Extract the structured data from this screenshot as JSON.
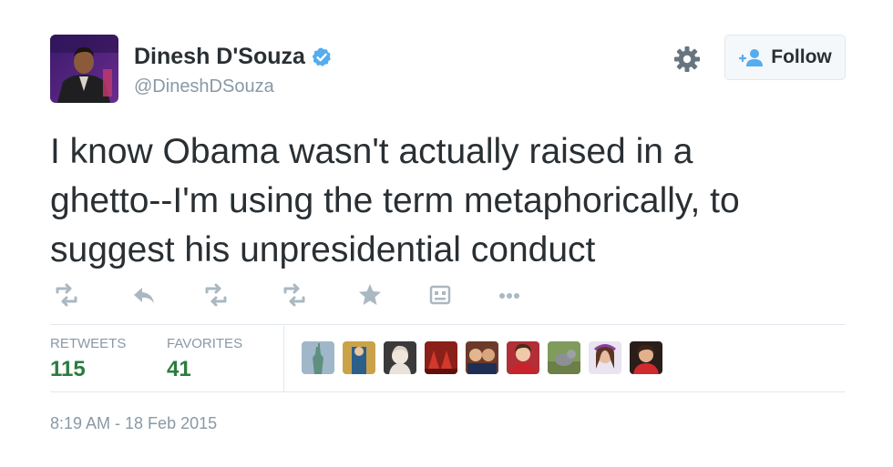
{
  "user": {
    "display_name": "Dinesh D'Souza",
    "handle": "@DineshDSouza"
  },
  "follow_button": {
    "label": "Follow"
  },
  "tweet": {
    "lines": [
      "I know Obama wasn't actually raised in a",
      "ghetto--I'm using the term metaphorically, to",
      "suggest his unpresidential conduct"
    ]
  },
  "actions": [
    "retweet-icon",
    "reply-icon",
    "retweet-icon",
    "retweet-icon",
    "star-icon",
    "media-icon",
    "more-icon"
  ],
  "stats": {
    "retweets_label": "RETWEETS",
    "retweets_value": "115",
    "favorites_label": "FAVORITES",
    "favorites_value": "41"
  },
  "timestamp": "8:19 AM - 18 Feb 2015",
  "colors": {
    "text": "#292f33",
    "muted": "#8899a6",
    "verified": "#55acee",
    "stat_value": "#2b7c3e",
    "border": "#e1e8ed"
  }
}
